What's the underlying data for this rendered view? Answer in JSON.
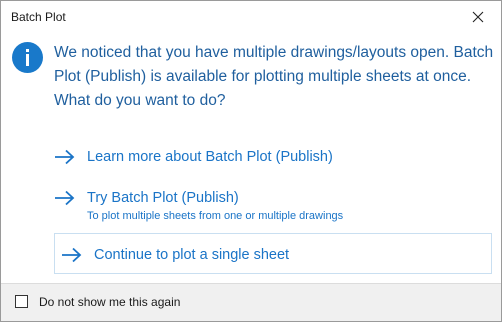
{
  "window": {
    "title": "Batch Plot",
    "close_icon": "close-icon"
  },
  "message": {
    "icon": "info-icon",
    "text": "We noticed that you have multiple drawings/layouts open. Batch Plot (Publish) is available for plotting multiple sheets at once. What do you want to do?"
  },
  "options": [
    {
      "label": "Learn more about Batch Plot (Publish)",
      "sublabel": ""
    },
    {
      "label": "Try Batch Plot (Publish)",
      "sublabel": "To plot multiple sheets from one or multiple drawings"
    },
    {
      "label": "Continue to plot a single sheet",
      "sublabel": ""
    }
  ],
  "footer": {
    "checkbox_label": "Do not show me this again",
    "checked": false
  },
  "colors": {
    "accent": "#1a74c7",
    "icon_fill": "#1979ca",
    "message_text": "#1f5f9e",
    "selected_border": "#c9dff1"
  }
}
